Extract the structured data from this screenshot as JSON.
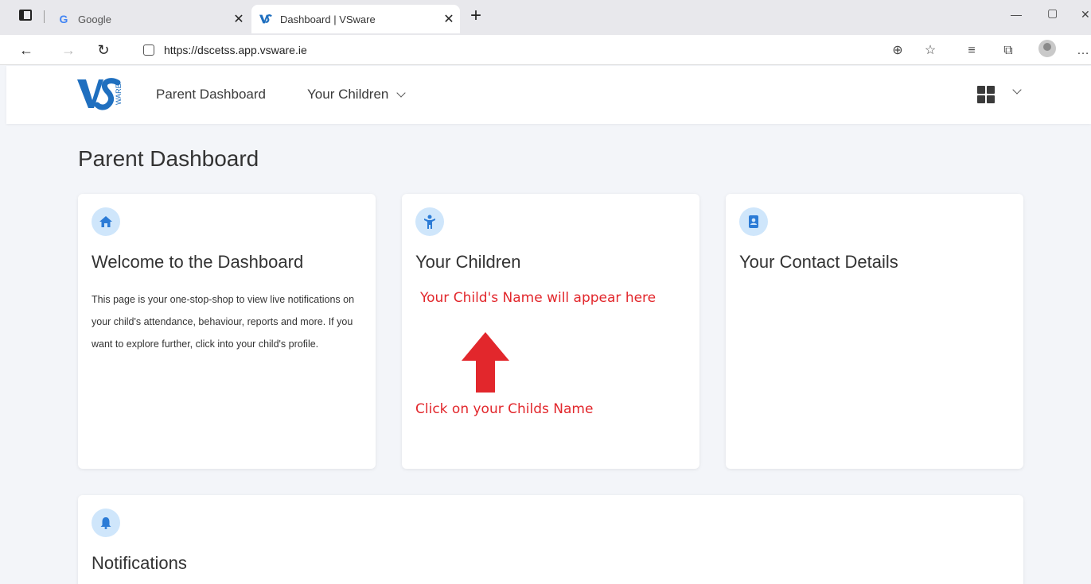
{
  "browser": {
    "tabs": [
      {
        "title": "Google",
        "favicon": "google-icon",
        "active": false
      },
      {
        "title": "Dashboard | VSware",
        "favicon": "vsware-icon",
        "active": true
      }
    ],
    "url": "https://dscetss.app.vsware.ie"
  },
  "header": {
    "logo_text": "VS WARE",
    "nav": {
      "dashboard": "Parent Dashboard",
      "children": "Your Children"
    }
  },
  "main": {
    "page_title": "Parent Dashboard",
    "cards": {
      "welcome": {
        "icon": "home-icon",
        "title": "Welcome to the Dashboard",
        "body": "This page is your one-stop-shop to view live notifications on your child's attendance, behaviour, reports and more. If you want to explore further, click into your child's profile."
      },
      "children": {
        "icon": "child-icon",
        "title": "Your Children",
        "annotation_top": "Your Child's Name will appear here",
        "annotation_bottom": "Click on your Childs Name"
      },
      "contact": {
        "icon": "contact-book-icon",
        "title": "Your Contact Details"
      },
      "notifications": {
        "icon": "bell-icon",
        "title": "Notifications"
      }
    }
  },
  "colors": {
    "accent_icon_bg": "#cfe6fb",
    "accent_icon_fg": "#2b7bd6",
    "annotation": "#e2272c",
    "page_bg": "#f3f5f9",
    "brand_blue": "#1f6fbf"
  }
}
